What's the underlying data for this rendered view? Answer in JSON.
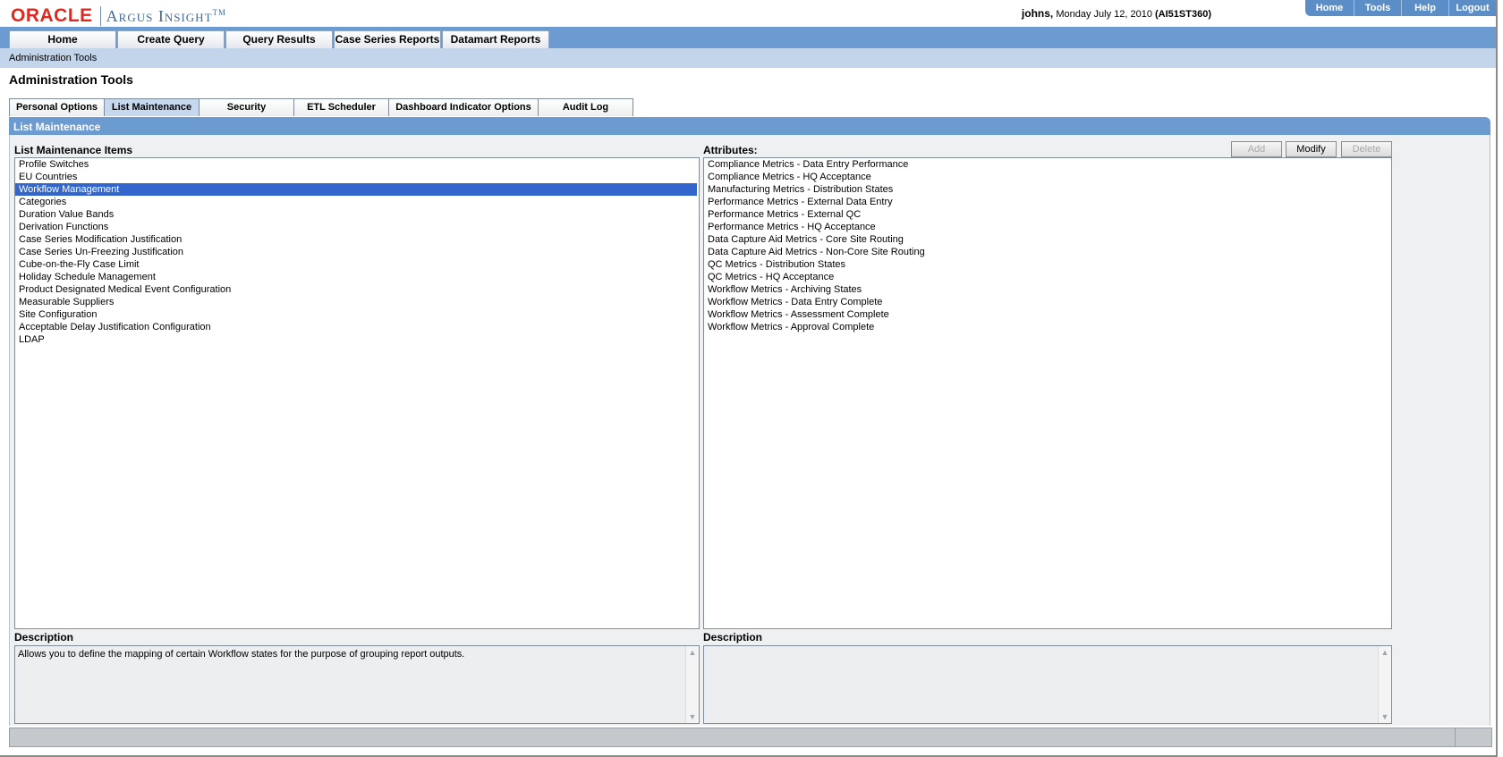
{
  "header": {
    "logo_brand": "ORACLE",
    "logo_product": "Argus Insight",
    "logo_tm": "TM",
    "user": "johns,",
    "date": "Monday July 12, 2010",
    "server": "(AI51ST360)",
    "links": [
      "Home",
      "Tools",
      "Help",
      "Logout"
    ]
  },
  "mainnav": {
    "items": [
      "Home",
      "Create Query",
      "Query Results",
      "Case Series Reports",
      "Datamart Reports"
    ]
  },
  "breadcrumb": "Administration Tools",
  "page_title": "Administration Tools",
  "tabs": [
    "Personal Options",
    "List Maintenance",
    "Security",
    "ETL Scheduler",
    "Dashboard Indicator Options",
    "Audit Log"
  ],
  "active_tab": "List Maintenance",
  "panel_title": "List Maintenance",
  "left": {
    "label": "List Maintenance Items",
    "items": [
      "Profile Switches",
      "EU Countries",
      "Workflow Management",
      "Categories",
      "Duration Value Bands",
      "Derivation Functions",
      "Case Series Modification Justification",
      "Case Series Un-Freezing Justification",
      "Cube-on-the-Fly Case Limit",
      "Holiday Schedule Management",
      "Product Designated Medical Event Configuration",
      "Measurable Suppliers",
      "Site Configuration",
      "Acceptable Delay Justification Configuration",
      "LDAP"
    ],
    "selected": "Workflow Management",
    "description_label": "Description",
    "description": "Allows you to define the mapping of certain Workflow states for the purpose of grouping report outputs."
  },
  "right": {
    "label": "Attributes:",
    "buttons": {
      "add": "Add",
      "modify": "Modify",
      "delete": "Delete"
    },
    "items": [
      "Compliance Metrics - Data Entry Performance",
      "Compliance Metrics - HQ Acceptance",
      "Manufacturing Metrics - Distribution States",
      "Performance Metrics - External Data Entry",
      "Performance Metrics - External QC",
      "Performance Metrics - HQ Acceptance",
      "Data Capture Aid Metrics - Core Site Routing",
      "Data Capture Aid Metrics - Non-Core Site Routing",
      "QC Metrics - Distribution States",
      "QC Metrics - HQ Acceptance",
      "Workflow Metrics - Archiving States",
      "Workflow Metrics - Data Entry Complete",
      "Workflow Metrics - Assessment Complete",
      "Workflow Metrics - Approval Complete"
    ],
    "description_label": "Description",
    "description": ""
  },
  "colors": {
    "nav_blue": "#6b9bd1",
    "subbar": "#c3d5ea",
    "selection": "#3366cc",
    "oracle_red": "#e0281e"
  }
}
